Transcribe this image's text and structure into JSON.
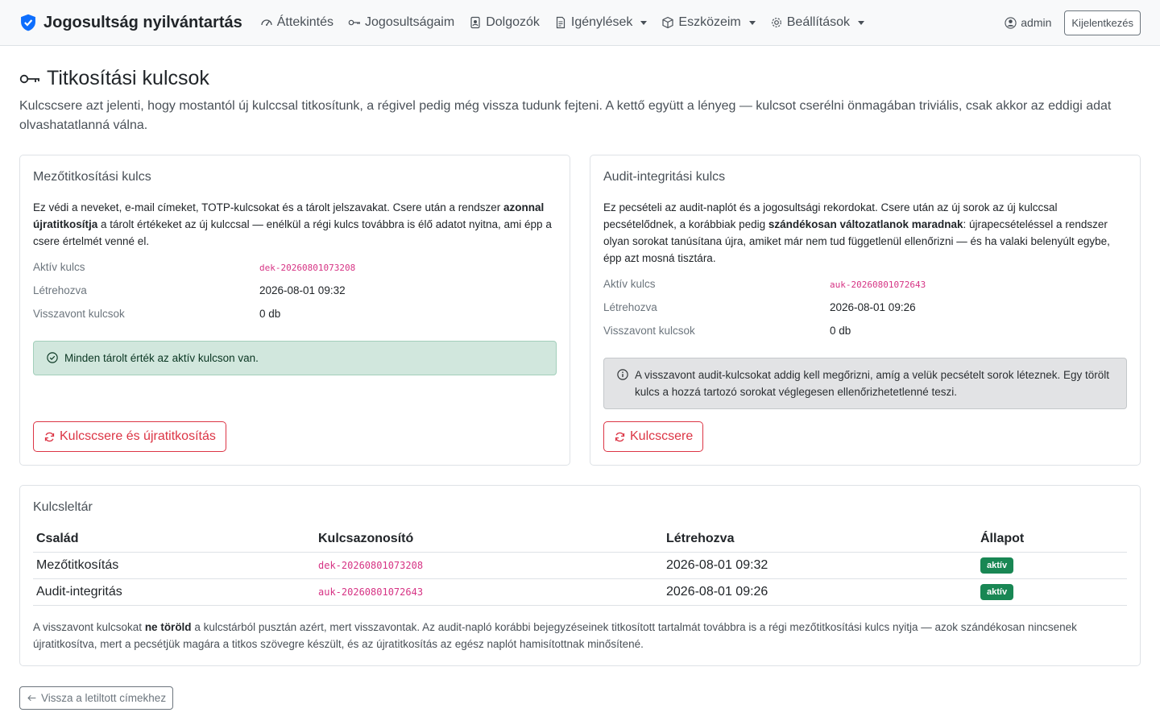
{
  "navbar": {
    "brand": "Jogosultság nyilvántartás",
    "items": [
      {
        "label": "Áttekintés",
        "icon": "speedometer-icon",
        "dropdown": false
      },
      {
        "label": "Jogosultságaim",
        "icon": "key-icon",
        "dropdown": false
      },
      {
        "label": "Dolgozók",
        "icon": "badge-icon",
        "dropdown": false
      },
      {
        "label": "Igénylések",
        "icon": "document-icon",
        "dropdown": true
      },
      {
        "label": "Eszközeim",
        "icon": "box-icon",
        "dropdown": true
      },
      {
        "label": "Beállítások",
        "icon": "gear-icon",
        "dropdown": true
      }
    ],
    "user": "admin",
    "logout": "Kijelentkezés"
  },
  "page": {
    "title": "Titkosítási kulcsok",
    "lead": "Kulcscsere azt jelenti, hogy mostantól új kulccsal titkosítunk, a régivel pedig még vissza tudunk fejteni. A kettő együtt a lényeg — kulcsot cserélni önmagában triviális, csak akkor az eddigi adat olvashatatlanná válna."
  },
  "dek_card": {
    "title": "Mezőtitkosítási kulcs",
    "text_1": "Ez védi a neveket, e-mail címeket, TOTP-kulcsokat és a tárolt jelszavakat. Csere után a rendszer ",
    "text_bold": "azonnal újratitkosítja",
    "text_2": " a tárolt értékeket az új kulccsal — enélkül a régi kulcs továbbra is élő adatot nyitna, ami épp a csere értelmét venné el.",
    "active_label": "Aktív kulcs",
    "active_value": "dek-20260801073208",
    "created_label": "Létrehozva",
    "created_value": "2026-08-01 09:32",
    "revoked_label": "Visszavont kulcsok",
    "revoked_value": "0 db",
    "alert": "Minden tárolt érték az aktív kulcson van.",
    "button": "Kulcscsere és újratitkosítás"
  },
  "auk_card": {
    "title": "Audit-integritási kulcs",
    "text_1": "Ez pecsételi az audit-naplót és a jogosultsági rekordokat. Csere után az új sorok az új kulccsal pecsételődnek, a korábbiak pedig ",
    "text_bold": "szándékosan változatlanok maradnak",
    "text_2": ": újrapecsételéssel a rendszer olyan sorokat tanúsítana újra, amiket már nem tud függetlenül ellenőrizni — és ha valaki belenyúlt egybe, épp azt mosná tisztára.",
    "active_label": "Aktív kulcs",
    "active_value": "auk-20260801072643",
    "created_label": "Létrehozva",
    "created_value": "2026-08-01 09:26",
    "revoked_label": "Visszavont kulcsok",
    "revoked_value": "0 db",
    "alert": "A visszavont audit-kulcsokat addig kell megőrizni, amíg a velük pecsételt sorok léteznek. Egy törölt kulcs a hozzá tartozó sorokat véglegesen ellenőrizhetetlenné teszi.",
    "button": "Kulcscsere"
  },
  "inventory": {
    "title": "Kulcsleltár",
    "headers": [
      "Család",
      "Kulcsazonosító",
      "Létrehozva",
      "Állapot"
    ],
    "rows": [
      {
        "family": "Mezőtitkosítás",
        "key_id": "dek-20260801073208",
        "created": "2026-08-01 09:32",
        "status": "aktív"
      },
      {
        "family": "Audit-integritás",
        "key_id": "auk-20260801072643",
        "created": "2026-08-01 09:26",
        "status": "aktív"
      }
    ],
    "note_1": "A visszavont kulcsokat ",
    "note_bold": "ne töröld",
    "note_2": " a kulcstárból pusztán azért, mert visszavontak. Az audit-napló korábbi bejegyzéseinek titkosított tartalmát továbbra is a régi mezőtitkosítási kulcs nyitja — azok szándékosan nincsenek újratitkosítva, mert a pecsétjük magára a titkos szövegre készült, és az újratitkosítás az egész naplót hamisítottnak minősítené."
  },
  "back_button": "Vissza a letiltott címekhez",
  "colors": {
    "danger": "#dc3545",
    "success": "#198754",
    "code": "#d63384",
    "brand_shield": "#0d6efd"
  }
}
